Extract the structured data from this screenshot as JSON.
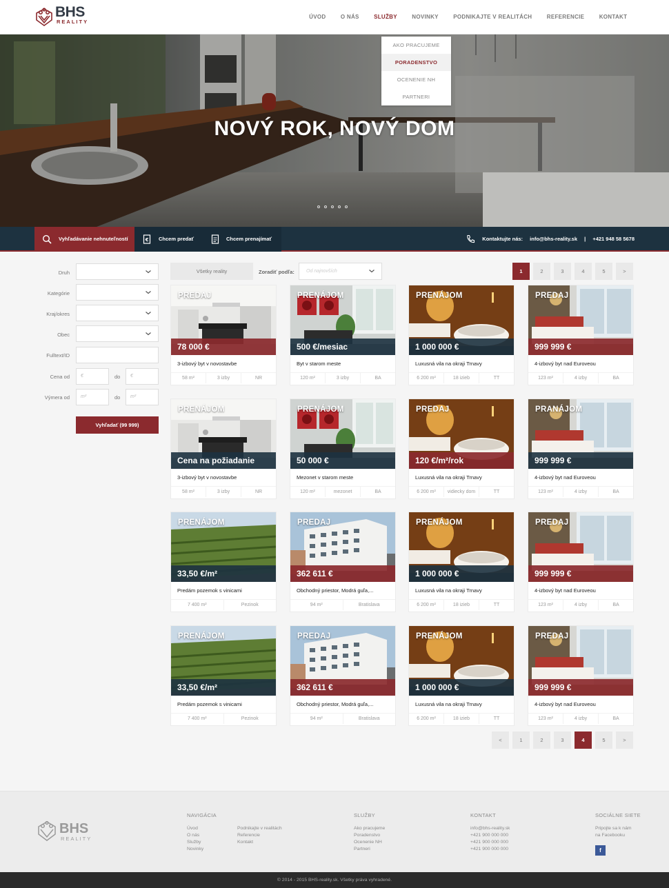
{
  "brand": {
    "name": "BHS",
    "sub": "REALITY"
  },
  "nav": [
    {
      "label": "Úvod",
      "active": false
    },
    {
      "label": "O nás",
      "active": false
    },
    {
      "label": "Služby",
      "active": true
    },
    {
      "label": "Novinky",
      "active": false
    },
    {
      "label": "Podnikajte v realitách",
      "active": false
    },
    {
      "label": "Referencie",
      "active": false
    },
    {
      "label": "Kontakt",
      "active": false
    }
  ],
  "services_menu": [
    "Ako pracujeme",
    "Poradenstvo",
    "Ocenenie NH",
    "Partneri"
  ],
  "hero": {
    "title": "NOVÝ ROK, NOVÝ DOM",
    "slides": 5
  },
  "searchbar": {
    "tabs": [
      "Vyhľadávanie nehnuteľností",
      "Chcem predať",
      "Chcem prenajímať"
    ],
    "contact_label": "Kontaktujte nás:",
    "email": "info@bhs-reality.sk",
    "separator": "|",
    "phone": "+421 948 58 5678"
  },
  "filters": {
    "druh": "Druh",
    "kategorie": "Kategórie",
    "kraj": "Kraj/okres",
    "obec": "Obec",
    "fulltext": "Fulltext/ID",
    "cena_od": "Cena od",
    "vymera_od": "Výmera od",
    "do": "do",
    "price_placeholder": "€",
    "area_placeholder": "m²",
    "search_button": "Vyhľadať (99 999)"
  },
  "toolbar": {
    "all_button": "Všetky reality",
    "sort_label": "Zoradiť podľa:",
    "sort_placeholder": "Od najnovších"
  },
  "pagination_top": [
    "1",
    "2",
    "3",
    "4",
    "5",
    ">"
  ],
  "pagination_bottom": [
    "<",
    "1",
    "2",
    "3",
    "4",
    "5",
    ">"
  ],
  "listings": [
    {
      "type": "PREDAJ",
      "price": "78 000 €",
      "title": "3-izbový byt v novostavbe",
      "meta": [
        "58 m²",
        "3 izby",
        "NR"
      ],
      "scene": "kitchen",
      "band": "red"
    },
    {
      "type": "PRENÁJOM",
      "price": "500 €/mesiac",
      "title": "Byt v starom meste",
      "meta": [
        "120 m²",
        "3 izby",
        "BA"
      ],
      "scene": "living",
      "band": "dark"
    },
    {
      "type": "PRENÁJOM",
      "price": "1 000 000 €",
      "title": "Luxusná vila na okraji Trnavy",
      "meta": [
        "6 200 m²",
        "18 izieb",
        "TT"
      ],
      "scene": "bath",
      "band": "dark"
    },
    {
      "type": "PREDAJ",
      "price": "999 999 €",
      "title": "4-izbový byt nad Euroveou",
      "meta": [
        "123 m²",
        "4 izby",
        "BA"
      ],
      "scene": "bedroom",
      "band": "red"
    },
    {
      "type": "PRENÁJOM",
      "price": "Cena na požiadanie",
      "title": "3-izbový byt v novostavbe",
      "meta": [
        "58 m²",
        "3 izby",
        "NR"
      ],
      "scene": "kitchen",
      "band": "dark"
    },
    {
      "type": "PRENÁJOM",
      "price": "50 000 €",
      "title": "Mezonet v starom meste",
      "meta": [
        "120 m²",
        "mezonet",
        "BA"
      ],
      "scene": "living",
      "band": "dark"
    },
    {
      "type": "PREDAJ",
      "price": "120 €/m²/rok",
      "title": "Luxusná vila na okraji Trnavy",
      "meta": [
        "6 200 m²",
        "vidiecky dom",
        "TT"
      ],
      "scene": "bath",
      "band": "red"
    },
    {
      "type": "PRANÁJOM",
      "price": "999 999 €",
      "title": "4-izbový byt nad Euroveou",
      "meta": [
        "123 m²",
        "4 izby",
        "BA"
      ],
      "scene": "bedroom",
      "band": "dark"
    },
    {
      "type": "PRENÁJOM",
      "price": "33,50 €/m²",
      "title": "Predám pozemok s vinicami",
      "meta": [
        "7 400 m²",
        "Pezinok"
      ],
      "scene": "vineyard",
      "band": "dark"
    },
    {
      "type": "PREDAJ",
      "price": "362 611 €",
      "title": "Obchodný priestor, Modrá guľa,...",
      "meta": [
        "94 m²",
        "Bratislava"
      ],
      "scene": "building",
      "band": "red"
    },
    {
      "type": "PRENÁJOM",
      "price": "1 000 000 €",
      "title": "Luxusná vila na okraji Trnavy",
      "meta": [
        "6 200 m²",
        "18 izieb",
        "TT"
      ],
      "scene": "bath",
      "band": "dark"
    },
    {
      "type": "PREDAJ",
      "price": "999 999 €",
      "title": "4-izbový byt nad Euroveou",
      "meta": [
        "123 m²",
        "4 izby",
        "BA"
      ],
      "scene": "bedroom",
      "band": "red"
    },
    {
      "type": "PRENÁJOM",
      "price": "33,50 €/m²",
      "title": "Predám pozemok s vinicami",
      "meta": [
        "7 400 m²",
        "Pezinok"
      ],
      "scene": "vineyard",
      "band": "dark"
    },
    {
      "type": "PREDAJ",
      "price": "362 611 €",
      "title": "Obchodný priestor, Modrá guľa,...",
      "meta": [
        "94 m²",
        "Bratislava"
      ],
      "scene": "building",
      "band": "red"
    },
    {
      "type": "PRENÁJOM",
      "price": "1 000 000 €",
      "title": "Luxusná vila na okraji Trnavy",
      "meta": [
        "6 200 m²",
        "18 izieb",
        "TT"
      ],
      "scene": "bath",
      "band": "dark"
    },
    {
      "type": "PREDAJ",
      "price": "999 999 €",
      "title": "4-izbový byt nad Euroveou",
      "meta": [
        "123 m²",
        "4 izby",
        "BA"
      ],
      "scene": "bedroom",
      "band": "red"
    }
  ],
  "footer": {
    "nav_heading": "Navigácia",
    "nav_col1": [
      "Úvod",
      "O nás",
      "Služby",
      "Novinky"
    ],
    "nav_col2": [
      "Podnikajte v realitách",
      "Referencie",
      "Kontakt"
    ],
    "services_heading": "Služby",
    "services": [
      "Ako pracujeme",
      "Poradenstvo",
      "Ocenenie NH",
      "Partneri"
    ],
    "contact_heading": "Kontakt",
    "contact": [
      "info@bhs-reality.sk",
      "+421 900 000 000",
      "+421 900 000 000",
      "+421 900 000 000"
    ],
    "social_heading": "Sociálne siete",
    "social_text": [
      "Pripojte sa k nám",
      "na Facebooku"
    ],
    "facebook_glyph": "f",
    "copyright": "© 2014 - 2015 BHS-reality.sk. Všetky práva vyhradené."
  },
  "colors": {
    "accent": "#8b2a2e",
    "navy": "#1d3240"
  }
}
